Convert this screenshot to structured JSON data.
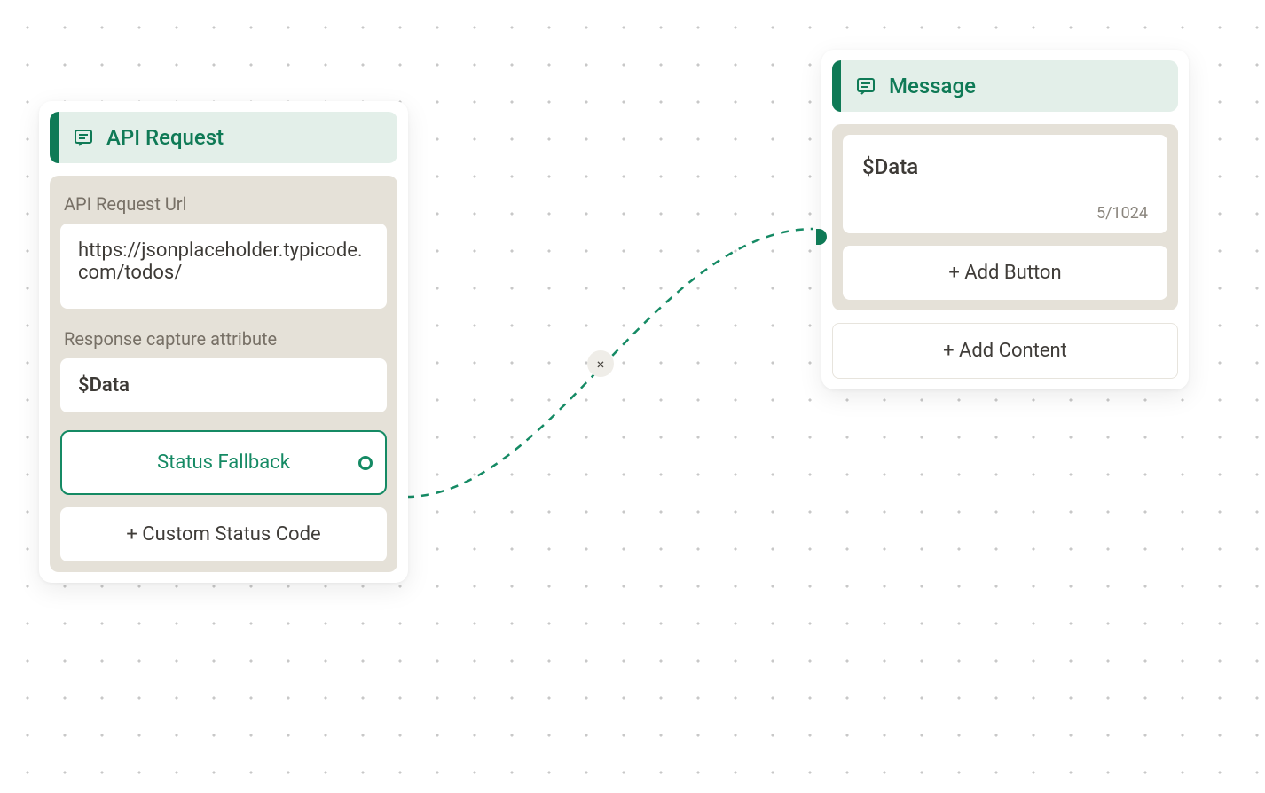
{
  "api_node": {
    "title": "API Request",
    "url_label": "API Request Url",
    "url_value": "https://jsonplaceholder.typicode.com/todos/",
    "capture_label": "Response capture attribute",
    "capture_value": "$Data",
    "fallback_label": "Status Fallback",
    "add_status_label": "+ Custom Status Code"
  },
  "message_node": {
    "title": "Message",
    "text_value": "$Data",
    "char_count": "5/1024",
    "add_button_label": "+ Add Button",
    "add_content_label": "+ Add Content"
  },
  "connection": {
    "delete_symbol": "×"
  }
}
